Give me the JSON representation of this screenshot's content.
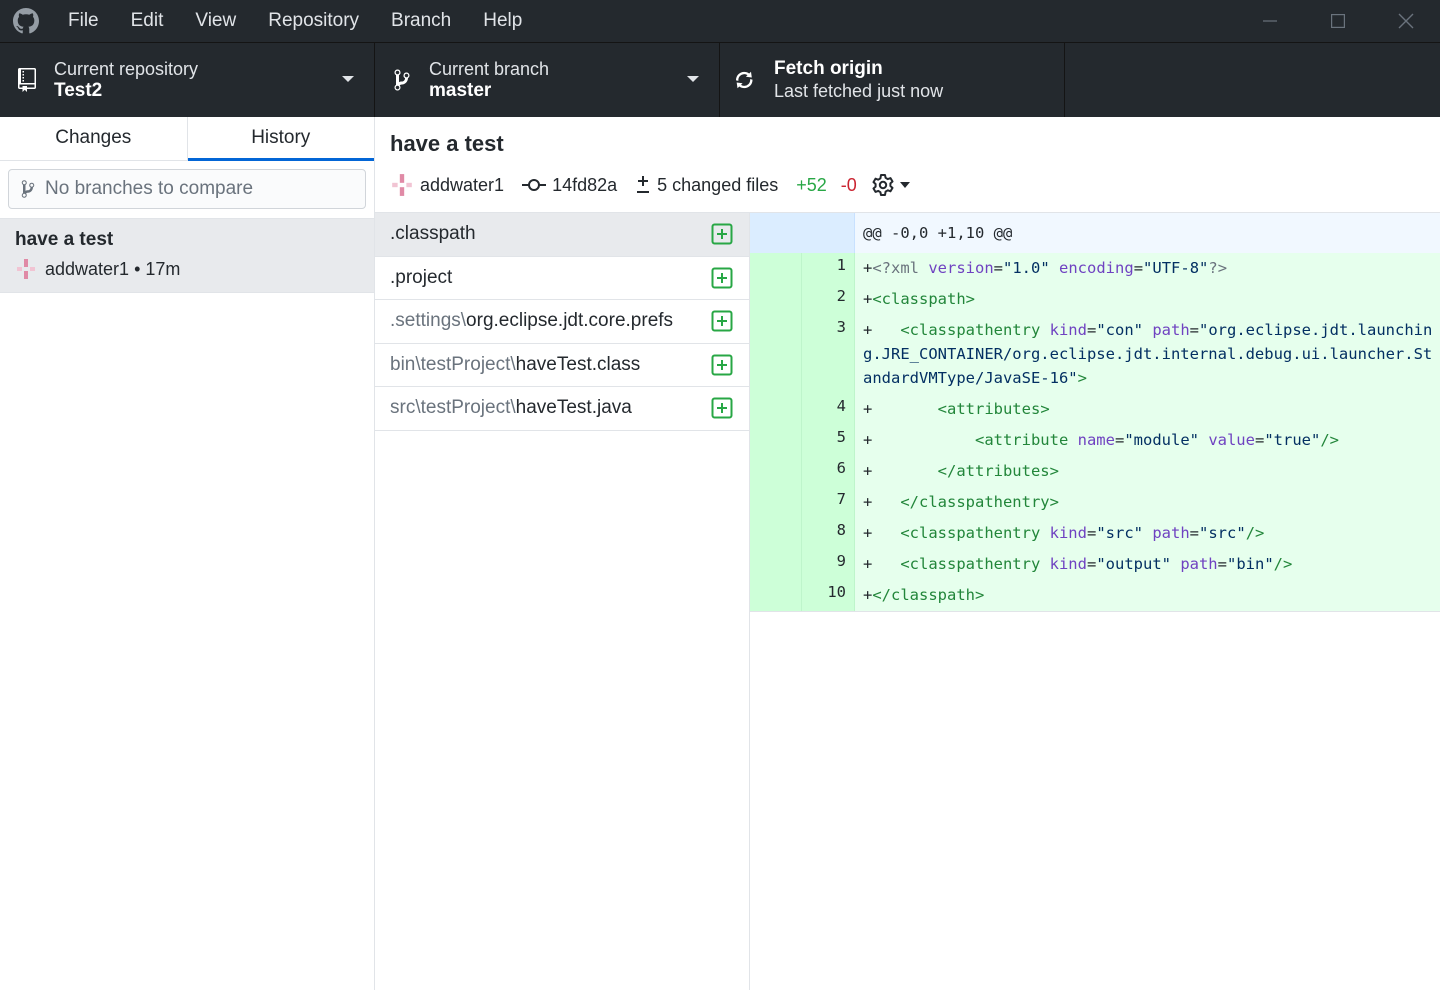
{
  "menu": [
    "File",
    "Edit",
    "View",
    "Repository",
    "Branch",
    "Help"
  ],
  "toolbar": {
    "repo_label": "Current repository",
    "repo_value": "Test2",
    "branch_label": "Current branch",
    "branch_value": "master",
    "fetch_label": "Fetch origin",
    "fetch_sub": "Last fetched just now"
  },
  "sidebar": {
    "tabs": [
      "Changes",
      "History"
    ],
    "active_tab": "History",
    "compare_placeholder": "No branches to compare",
    "commits": [
      {
        "title": "have a test",
        "author": "addwater1",
        "time": "17m"
      }
    ]
  },
  "commit": {
    "title": "have a test",
    "author": "addwater1",
    "sha": "14fd82a",
    "changed_files": "5 changed files",
    "additions": "+52",
    "deletions": "-0"
  },
  "files": [
    {
      "dir": "",
      "name": ".classpath",
      "status": "added",
      "selected": true
    },
    {
      "dir": "",
      "name": ".project",
      "status": "added"
    },
    {
      "dir": ".settings\\",
      "name": "org.eclipse.jdt.core.prefs",
      "status": "added"
    },
    {
      "dir": "bin\\testProject\\",
      "name": "haveTest.class",
      "status": "added"
    },
    {
      "dir": "src\\testProject\\",
      "name": "haveTest.java",
      "status": "added"
    }
  ],
  "diff": {
    "hunk_header": "@@ -0,0 +1,10 @@",
    "lines": [
      {
        "num": "1",
        "text": "+<?xml version=\"1.0\" encoding=\"UTF-8\"?>"
      },
      {
        "num": "2",
        "text": "+<classpath>"
      },
      {
        "num": "3",
        "text": "+   <classpathentry kind=\"con\" path=\"org.eclipse.jdt.launching.JRE_CONTAINER/org.eclipse.jdt.internal.debug.ui.launcher.StandardVMType/JavaSE-16\">"
      },
      {
        "num": "4",
        "text": "+       <attributes>"
      },
      {
        "num": "5",
        "text": "+           <attribute name=\"module\" value=\"true\"/>"
      },
      {
        "num": "6",
        "text": "+       </attributes>"
      },
      {
        "num": "7",
        "text": "+   </classpathentry>"
      },
      {
        "num": "8",
        "text": "+   <classpathentry kind=\"src\" path=\"src\"/>"
      },
      {
        "num": "9",
        "text": "+   <classpathentry kind=\"output\" path=\"bin\"/>"
      },
      {
        "num": "10",
        "text": "+</classpath>"
      }
    ]
  },
  "colors": {
    "titlebar": "#24292e",
    "accent": "#0366d6",
    "added": "#28a745",
    "removed": "#cb2431",
    "diff_add_bg": "#e6ffed"
  }
}
